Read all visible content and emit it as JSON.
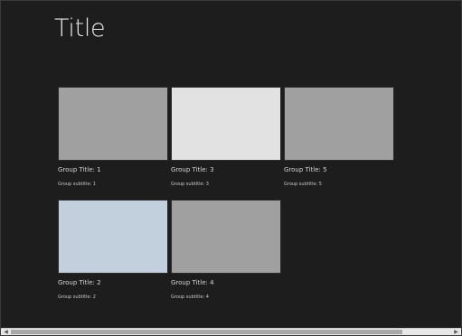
{
  "page": {
    "title": "Title"
  },
  "groups": [
    {
      "title": "Group Title: 1",
      "subtitle": "Group subtitle: 1",
      "color": "#a0a0a0"
    },
    {
      "title": "Group Title: 3",
      "subtitle": "Group subtitle: 3",
      "color": "#e2e2e2"
    },
    {
      "title": "Group Title: 5",
      "subtitle": "Group subtitle: 5",
      "color": "#a0a0a0"
    },
    {
      "title": "Group Title: 2",
      "subtitle": "Group subtitle: 2",
      "color": "#c2d0dd"
    },
    {
      "title": "Group Title: 4",
      "subtitle": "Group subtitle: 4",
      "color": "#a0a0a0"
    }
  ],
  "scrollbar": {
    "left_arrow_icon": "chevron-left-icon",
    "right_arrow_icon": "chevron-right-icon"
  }
}
